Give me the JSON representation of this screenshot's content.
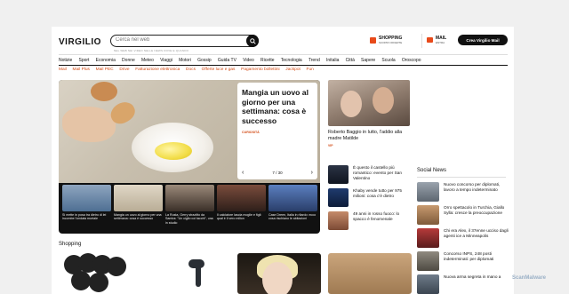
{
  "header": {
    "logo": "VIRGILIO",
    "search_placeholder": "Cerca nel web",
    "search_sub": "NEL WEB   NEI VIDEO   NELLE NEWS   DOVE E QUANDO",
    "shopping_label": "SHOPPING",
    "shopping_sub": "SCOPRI OFFERTE",
    "mail_label": "MAIL",
    "mail_sub": "ENTRA",
    "cta": "Crea Virgilio Mail"
  },
  "main_nav": [
    "Notizie",
    "Sport",
    "Economia",
    "Donne",
    "Meteo",
    "Viaggi",
    "Motori",
    "Gossip",
    "Guida TV",
    "Video",
    "Ricette",
    "Tecnologia",
    "Trend",
    "Initalia",
    "Città",
    "Sapere",
    "Scuola",
    "Oroscopo"
  ],
  "sub_nav": [
    "Mail",
    "Mail Plus",
    "Mail PEC",
    "Drive",
    "Fatturazione elettronica",
    "Docs",
    "Offerte luce e gas",
    "Pagamento bollettini",
    "Jackpot",
    "Fun"
  ],
  "hero": {
    "title": "Mangia un uovo al giorno per una settimana: cosa è successo",
    "category": "CURIOSITÀ",
    "pager": "7 / 30",
    "thumbs": [
      {
        "caption": "Si mette in posa tra dietro di lei incombe l'ondata mortale"
      },
      {
        "caption": "Mangia un uovo al giorno per una settimana: cosa è successo"
      },
      {
        "caption": "La Rusta, Gerry strazitto da Samira: \"Un ciglio coi tacchi\", una in studio"
      },
      {
        "caption": "Il calciatore lascia moglie e figli: qual è il vero milion"
      },
      {
        "caption": "Case Dreen, Italia in rilardo: ecco cosa rischiano le abitazioni"
      }
    ]
  },
  "side_story": {
    "title": "Roberto Baggio in lutto, l'addio alla madre Matilde",
    "category": "VIP"
  },
  "small_list": [
    {
      "title": "È questo il castello più romantico: evento per San Valentino"
    },
    {
      "title": "Khaby vende tutto per 975 milioni: cosa c'è dietro"
    },
    {
      "title": "49 anni in rosso fuoco: lo spacco è fenomenale"
    }
  ],
  "social": {
    "heading": "Social News",
    "items": [
      {
        "title": "Nuovo concorso per diplomati, lavoro a tempo indeterminato"
      },
      {
        "title": "Orro spettacolo in Turchia, Giallo Sylla: cresce la preoccupazione"
      },
      {
        "title": "Chi era Alex, il 37enne ucciso dagli agenti ice a Minneapolis"
      },
      {
        "title": "Concorso INPS, 248 posti indeterminati: per diplomati"
      },
      {
        "title": "Nuova arma segreta in mano a"
      }
    ]
  },
  "shopping": {
    "heading": "Shopping"
  },
  "watermark": "ScanMalware"
}
